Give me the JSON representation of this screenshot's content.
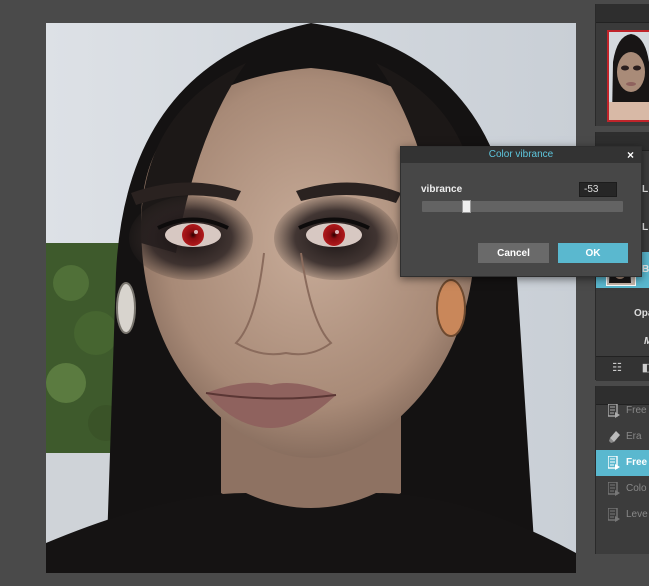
{
  "dialog": {
    "title": "Color vibrance",
    "close_label": "×",
    "vibrance_label": "vibrance",
    "vibrance_value": "-53",
    "slider_level_percent": 21,
    "cancel_label": "Cancel",
    "ok_label": "OK"
  },
  "layers": {
    "rows": [
      {
        "letter": "L"
      },
      {
        "letter": "L"
      },
      {
        "letter": "B"
      }
    ],
    "opacity_label": "Opa",
    "mode_label": "M"
  },
  "history": {
    "items": [
      {
        "label": "Free"
      },
      {
        "label": "Era"
      },
      {
        "label": "Free"
      },
      {
        "label": "Colo"
      },
      {
        "label": "Leve"
      }
    ]
  },
  "colors": {
    "accent": "#5ab8cf",
    "panel": "#3a3a3a",
    "dialog": "#474747",
    "selection_border": "#c0242a"
  },
  "icons": {
    "close": "close-icon",
    "layer_options": "adjust-icon",
    "history_step": "document-arrow-icon"
  }
}
